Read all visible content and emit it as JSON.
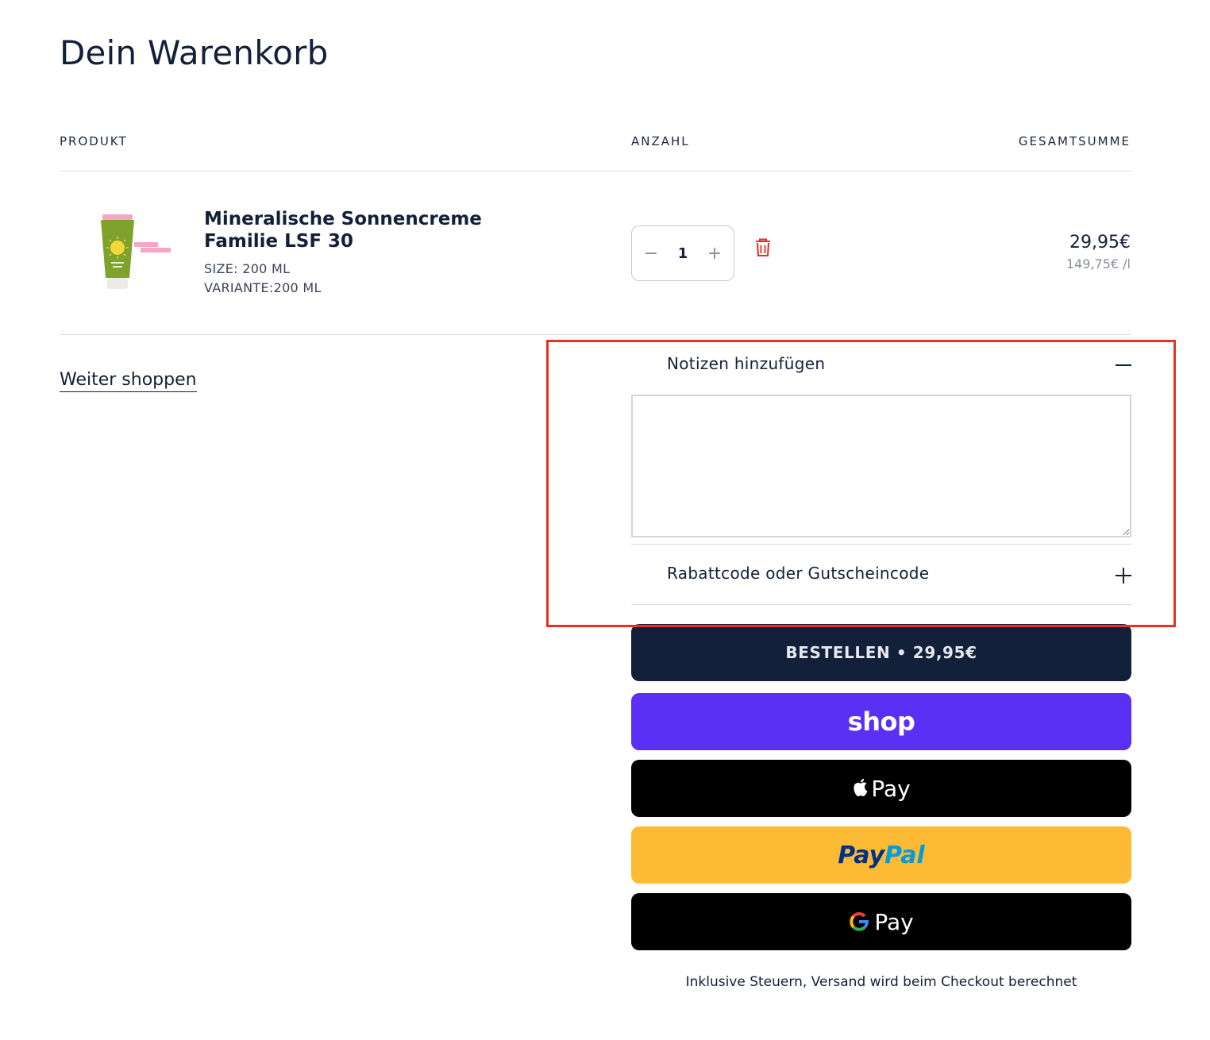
{
  "page": {
    "title": "Dein Warenkorb"
  },
  "columns": {
    "product": "PRODUKT",
    "quantity": "ANZAHL",
    "total": "GESAMTSUMME"
  },
  "item": {
    "name": "Mineralische Sonnencreme Familie LSF 30",
    "size": "SIZE: 200 ML",
    "variant": "VARIANTE:200 ML",
    "quantity": "1",
    "decrement_symbol": "−",
    "increment_symbol": "+",
    "price": "29,95€",
    "unit_price": "149,75€ /l",
    "image_icon": "sunscreen-tube",
    "delete_icon": "trash-icon"
  },
  "continue_link": "Weiter shoppen",
  "accordion": {
    "notes_label": "Notizen hinzufügen",
    "notes_value": "",
    "discount_label": "Rabattcode oder Gutscheincode"
  },
  "checkout": {
    "order_button": "BESTELLEN • 29,95€",
    "shop_pay": "shop",
    "apple_pay": "Pay",
    "paypal_part1": "Pay",
    "paypal_part2": "Pal",
    "google_pay": "Pay"
  },
  "footnote": "Inklusive Steuern, Versand wird beim Checkout berechnet",
  "colors": {
    "primary": "#132039",
    "shop": "#5a31f4",
    "paypal": "#fdbb35",
    "delete": "#e52b2b",
    "highlight": "#e8321f"
  }
}
